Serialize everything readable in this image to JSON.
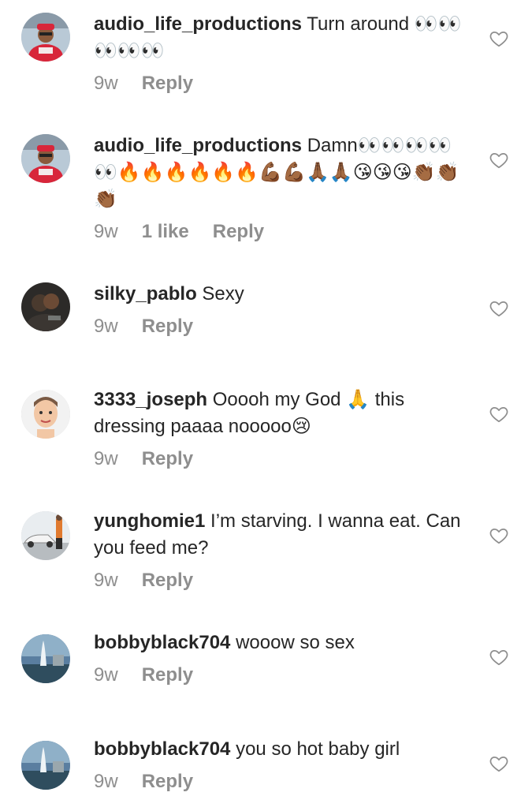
{
  "comments": [
    {
      "username": "audio_life_productions",
      "text": "Turn around 👀👀👀👀👀",
      "time": "9w",
      "likes": "",
      "reply_label": "Reply",
      "avatar": "person-in-car-avatar"
    },
    {
      "username": "audio_life_productions",
      "text": "Damn👀👀👀👀👀🔥🔥🔥🔥🔥🔥💪🏾💪🏾🙏🏾🙏🏾😘😘😘👏🏾👏🏾👏🏾",
      "time": "9w",
      "likes": "1 like",
      "reply_label": "Reply",
      "avatar": "person-in-car-avatar"
    },
    {
      "username": "silky_pablo",
      "text": "Sexy",
      "time": "9w",
      "likes": "",
      "reply_label": "Reply",
      "avatar": "couple-photo-avatar"
    },
    {
      "username": "3333_joseph",
      "text": "Ooooh my God 🙏  this dressing paaaa nooooo😢",
      "time": "9w",
      "likes": "",
      "reply_label": "Reply",
      "avatar": "cartoon-face-avatar"
    },
    {
      "username": "yunghomie1",
      "text": "I’m starving. I wanna eat. Can you feed me?",
      "time": "9w",
      "likes": "",
      "reply_label": "Reply",
      "avatar": "car-photo-avatar"
    },
    {
      "username": "bobbyblack704",
      "text": "wooow so sex",
      "time": "9w",
      "likes": "",
      "reply_label": "Reply",
      "avatar": "fountain-photo-avatar"
    },
    {
      "username": "bobbyblack704",
      "text": "you so hot baby girl",
      "time": "9w",
      "likes": "",
      "reply_label": "Reply",
      "avatar": "fountain-photo-avatar"
    }
  ],
  "icons": {
    "like": "heart-outline-icon"
  },
  "colors": {
    "text": "#262626",
    "secondary": "#8e8e8e",
    "background": "#ffffff"
  }
}
